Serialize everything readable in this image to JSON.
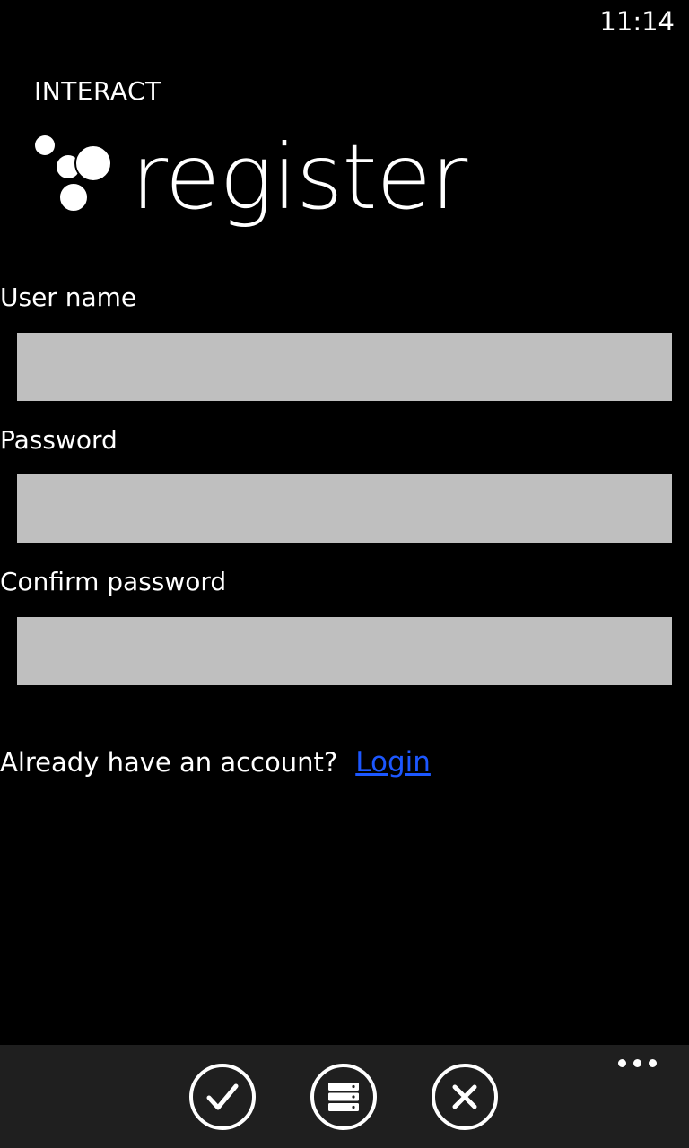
{
  "status_bar": {
    "time": "11:14"
  },
  "header": {
    "app_name": "INTERACT",
    "page_title": "register",
    "logo": "bubbles-logo-icon"
  },
  "form": {
    "username": {
      "label": "User name",
      "value": "",
      "placeholder": ""
    },
    "password": {
      "label": "Password",
      "value": "",
      "placeholder": ""
    },
    "confirm_password": {
      "label": "Confirm password",
      "value": "",
      "placeholder": ""
    }
  },
  "account_prompt": {
    "text": "Already have an account?",
    "link": "Login",
    "link_color": "#1c57ff"
  },
  "app_bar": {
    "buttons": [
      {
        "icon": "check-icon"
      },
      {
        "icon": "server-icon"
      },
      {
        "icon": "close-icon"
      }
    ],
    "more_icon": "ellipsis-icon",
    "background": "#1f1f1f"
  },
  "colors": {
    "background": "#000000",
    "input_background": "#bfbfbf",
    "text": "#ffffff"
  }
}
